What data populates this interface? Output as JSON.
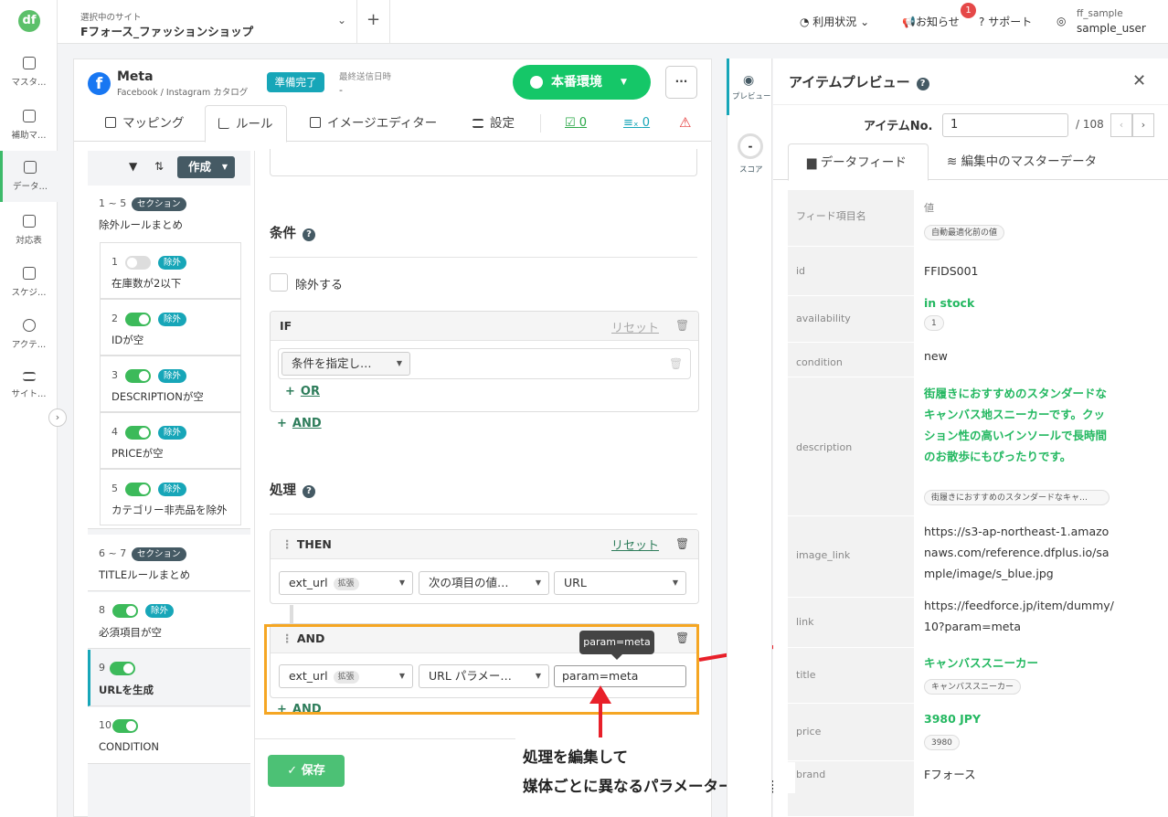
{
  "nav": {
    "logo": "df",
    "items": [
      {
        "label": "マスタ…"
      },
      {
        "label": "補助マ…"
      },
      {
        "label": "データ…"
      },
      {
        "label": "対応表"
      },
      {
        "label": "スケジ…"
      },
      {
        "label": "アクテ…"
      },
      {
        "label": "サイト…"
      }
    ],
    "toggle": "›"
  },
  "header": {
    "site_label": "選択中のサイト",
    "site_name": "Fフォース_ファッションショップ",
    "plus": "+",
    "usage": "利用状況",
    "notice": "お知らせ",
    "notice_count": "1",
    "support": "サポート",
    "user_id": "ff_sample",
    "user_name": "sample_user"
  },
  "channel": {
    "logo": "f",
    "name": "Meta",
    "sub": "Facebook / Instagram カタログ",
    "status": "準備完了",
    "last_sent_label": "最終送信日時",
    "last_sent_value": "-",
    "env_button": "本番環境",
    "more": "···"
  },
  "tabs": {
    "mapping": "マッピング",
    "rules": "ルール",
    "image_editor": "イメージエディター",
    "settings": "設定",
    "count_ok": "0",
    "count_x": "0",
    "warn": "⚠"
  },
  "rule_list": {
    "create": "作成",
    "groups": [
      {
        "num": "1 ~ 5",
        "badge": "セクション",
        "name": "除外ルールまとめ"
      },
      {
        "num": "6 ~ 7",
        "badge": "セクション",
        "name": "TITLEルールまとめ"
      }
    ],
    "sub_rules": [
      {
        "num": "1",
        "badge": "除外",
        "name": "在庫数が2以下"
      },
      {
        "num": "2",
        "badge": "除外",
        "name": "IDが空"
      },
      {
        "num": "3",
        "badge": "除外",
        "name": "DESCRIPTIONが空"
      },
      {
        "num": "4",
        "badge": "除外",
        "name": "PRICEが空"
      },
      {
        "num": "5",
        "badge": "除外",
        "name": "カテゴリー非売品を除外"
      }
    ],
    "rules": [
      {
        "num": "8",
        "badge": "除外",
        "name": "必須項目が空"
      },
      {
        "num": "9",
        "name": "URLを生成"
      },
      {
        "num": "10",
        "name": "CONDITION"
      }
    ]
  },
  "editor": {
    "condition_title": "条件",
    "exclude_label": "除外する",
    "if_label": "IF",
    "reset": "リセット",
    "condition_select": "条件を指定し…",
    "or_label": "OR",
    "and_label": "AND",
    "process_title": "処理",
    "then_label": "THEN",
    "then_field": "ext_url",
    "ext_badge": "拡張",
    "then_op": "次の項目の値…",
    "then_value": "URL",
    "and_op": "URL パラメー…",
    "and_value": "param=meta",
    "tooltip": "param=meta",
    "save": "保存"
  },
  "annotation": {
    "line1": "処理を編集して",
    "line2": "媒体ごとに異なるパラメーターを付与"
  },
  "rail": {
    "preview": "プレビュー",
    "score_value": "-",
    "score": "スコア"
  },
  "preview": {
    "title": "アイテムプレビュー",
    "item_no_label": "アイテムNo.",
    "item_no": "1",
    "total": "/ 108",
    "tab_feed": "データフィード",
    "tab_master": "編集中のマスターデータ",
    "header_key": "フィード項目名",
    "header_value": "値",
    "header_pill": "自動最適化前の値",
    "rows": [
      {
        "key": "id",
        "value": "FFIDS001"
      },
      {
        "key": "availability",
        "value": "in stock",
        "orig": "1"
      },
      {
        "key": "condition",
        "value": "new"
      },
      {
        "key": "description",
        "value": "街履きにおすすめのスタンダードなキャンバス地スニーカーです。クッション性の高いインソールで長時間のお散歩にもぴったりです。",
        "orig": "街履きにおすすめのスタンダードなキャ…"
      },
      {
        "key": "image_link",
        "value": "https://s3-ap-northeast-1.amazonaws.com/reference.dfplus.io/sample/image/s_blue.jpg"
      },
      {
        "key": "link",
        "value": "https://feedforce.jp/item/dummy/10?param=meta"
      },
      {
        "key": "title",
        "value": "キャンバススニーカー",
        "orig": "キャンバススニーカー"
      },
      {
        "key": "price",
        "value": "3980 JPY",
        "orig": "3980"
      },
      {
        "key": "brand",
        "value": "Fフォース"
      }
    ]
  },
  "colors": {
    "brand_green": "#15c768",
    "teal": "#17a6b8",
    "highlight": "#f5a623",
    "arrow": "#e8202a"
  }
}
